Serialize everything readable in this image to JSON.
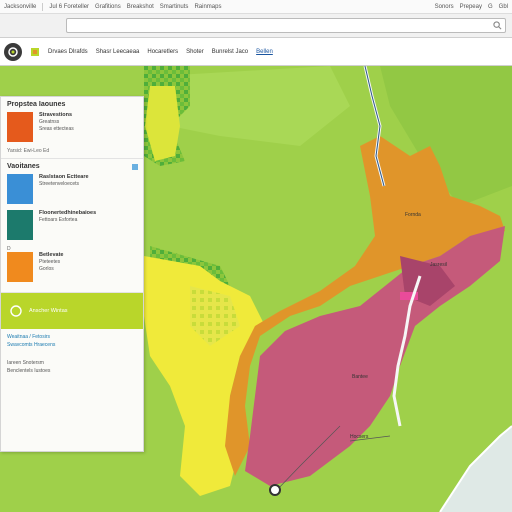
{
  "topbar": {
    "items": [
      "Jacksonville",
      "Jul 6 Foreteller",
      "Grafitions",
      "Breakshot",
      "Smartinuts",
      "Rainmaps"
    ],
    "right_items": [
      "Sonors",
      "Prepeay",
      "G",
      "Gbl"
    ]
  },
  "searchbar": {
    "left_text": "",
    "placeholder": "",
    "value": ""
  },
  "tabs": [
    "Drvaes Dlrafds",
    "Shasr Leecaeaa",
    "Hocaretlers",
    "Shoter",
    "Bunrelst Jaco",
    "Bellen"
  ],
  "panel": {
    "section1": {
      "title": "Propstea Iaounes",
      "entries": [
        {
          "title": "Stravestions",
          "lines": [
            "Greatnss",
            "Sreas ettecteas"
          ],
          "color": "#e55a1c"
        }
      ],
      "note": "Yarsid: Ewi-Leo Ed"
    },
    "section2": {
      "title": "Vaoitanes",
      "entries": [
        {
          "title": "Raslstaon Ectteare",
          "lines": [
            "Streetenveloecets",
            ""
          ],
          "color": "#3a8fd6"
        },
        {
          "title": "Floonertedhinebaioes",
          "lines": [
            "Fettoars Esfortea"
          ],
          "color": "#1c7a6c"
        },
        {
          "title": "Betlevate",
          "lines": [
            "Pteteetes",
            "Gorlos"
          ],
          "color": "#f08a1e"
        }
      ],
      "marker": "D"
    },
    "green_bar": {
      "label": "Anscher Wintas"
    },
    "footer": {
      "lines": [
        "Weaitnaa / Fetosirs",
        "Swavcomts Hraecens"
      ],
      "bottom_lines": [
        "Iareen Snotersm",
        "Benclentels Iustoes"
      ]
    }
  },
  "map": {
    "labels": [
      "Fornda",
      "Jasresil",
      "Bantee",
      "Hocsers"
    ]
  },
  "colors": {
    "land_green": "#9fd04a",
    "yellow": "#f2e93a",
    "orange": "#e0952a",
    "magenta": "#c55a7a",
    "water": "#dfe9e6"
  }
}
